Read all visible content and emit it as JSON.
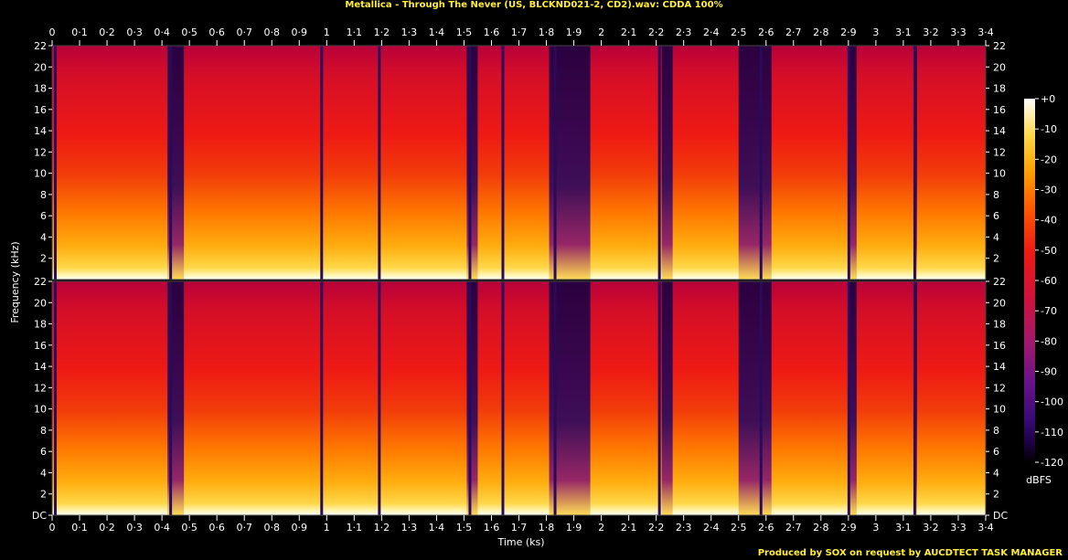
{
  "title": "Metallica - Through The Never (US, BLCKND021-2, CD2).wav: CDDA 100%",
  "footer": "Produced by SOX on request by AUCDTECT TASK MANAGER",
  "chart_data": {
    "type": "heatmap",
    "xlabel": "Time (ks)",
    "ylabel": "Frequency (kHz)",
    "colorbar_label": "dBFS",
    "xlim": [
      0,
      3.4
    ],
    "ylim_khz": [
      0,
      22
    ],
    "clim_dbfs": [
      -120,
      0
    ],
    "x_ticks": [
      "0",
      "0·1",
      "0·2",
      "0·3",
      "0·4",
      "0·5",
      "0·6",
      "0·7",
      "0·8",
      "0·9",
      "1",
      "1·1",
      "1·2",
      "1·3",
      "1·4",
      "1·5",
      "1·6",
      "1·7",
      "1·8",
      "1·9",
      "2",
      "2·1",
      "2·2",
      "2·3",
      "2·4",
      "2·5",
      "2·6",
      "2·7",
      "2·8",
      "2·9",
      "3",
      "3·1",
      "3·2",
      "3·3",
      "3·4"
    ],
    "y_ticks_top": [
      "22",
      "20",
      "18",
      "16",
      "14",
      "12",
      "10",
      "8",
      "6",
      "4",
      "2"
    ],
    "y_ticks_bottom": [
      "22",
      "20",
      "18",
      "16",
      "14",
      "12",
      "10",
      "8",
      "6",
      "4",
      "2",
      "DC"
    ],
    "y_ticks_right_top": [
      "22",
      "20",
      "18",
      "16",
      "14",
      "12",
      "10",
      "8",
      "6",
      "4",
      "2"
    ],
    "y_ticks_right_bottom": [
      "22",
      "20",
      "18",
      "16",
      "14",
      "12",
      "10",
      "8",
      "6",
      "4",
      "2",
      "DC"
    ],
    "colorbar_ticks": [
      "+0",
      "-10",
      "-20",
      "-30",
      "-40",
      "-50",
      "-60",
      "-70",
      "-80",
      "-90",
      "-100",
      "-110",
      "-120"
    ],
    "channels": 2,
    "track_gaps_ks": [
      0.01,
      0.43,
      0.98,
      1.19,
      1.52,
      1.64,
      1.83,
      2.21,
      2.58,
      2.9,
      3.14
    ],
    "quiet_sections_ks": [
      [
        0.42,
        0.48
      ],
      [
        1.51,
        1.55
      ],
      [
        1.81,
        1.96
      ],
      [
        2.22,
        2.26
      ],
      [
        2.5,
        2.62
      ],
      [
        2.9,
        2.93
      ],
      [
        3.14,
        3.15
      ]
    ],
    "colormap": [
      "#000000",
      "#1b0040",
      "#3a0a78",
      "#6a138a",
      "#a1186e",
      "#d0123c",
      "#ee1a14",
      "#ff5a00",
      "#ffa000",
      "#ffd84a",
      "#ffffff"
    ]
  }
}
